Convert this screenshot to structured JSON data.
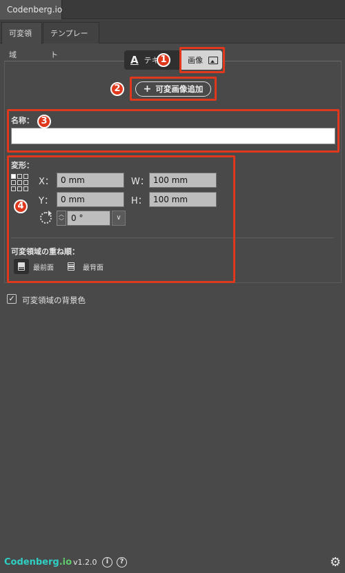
{
  "app": {
    "title": "Codenberg.io"
  },
  "tabs": [
    {
      "label": "可変領域",
      "active": true
    },
    {
      "label": "テンプレート",
      "active": false
    }
  ],
  "mode_toggle": {
    "text_label": "テキ",
    "image_label": "画像",
    "selected": "image"
  },
  "add_button": {
    "label": "可変画像追加"
  },
  "name": {
    "label": "名称：",
    "value": ""
  },
  "transform": {
    "label": "変形：",
    "x": {
      "label": "X：",
      "value": "0 mm"
    },
    "y": {
      "label": "Y：",
      "value": "0 mm"
    },
    "w": {
      "label": "W：",
      "value": "100 mm"
    },
    "h": {
      "label": "H：",
      "value": "100 mm"
    },
    "rotation": {
      "value": "0 °"
    }
  },
  "stack_order": {
    "label": "可変領域の重ね順：",
    "front_label": "最前面",
    "back_label": "最背面"
  },
  "background": {
    "label": "可変領域の背景色",
    "checked": true
  },
  "annotations": [
    "1",
    "2",
    "3",
    "4"
  ],
  "footer": {
    "logo_part1": "Codenberg",
    "logo_part2": ".io",
    "version": "v1.2.0"
  },
  "colors": {
    "annotation_red": "#e0381d",
    "logo_teal": "#2fd0c4",
    "logo_green": "#5ecb6c"
  }
}
